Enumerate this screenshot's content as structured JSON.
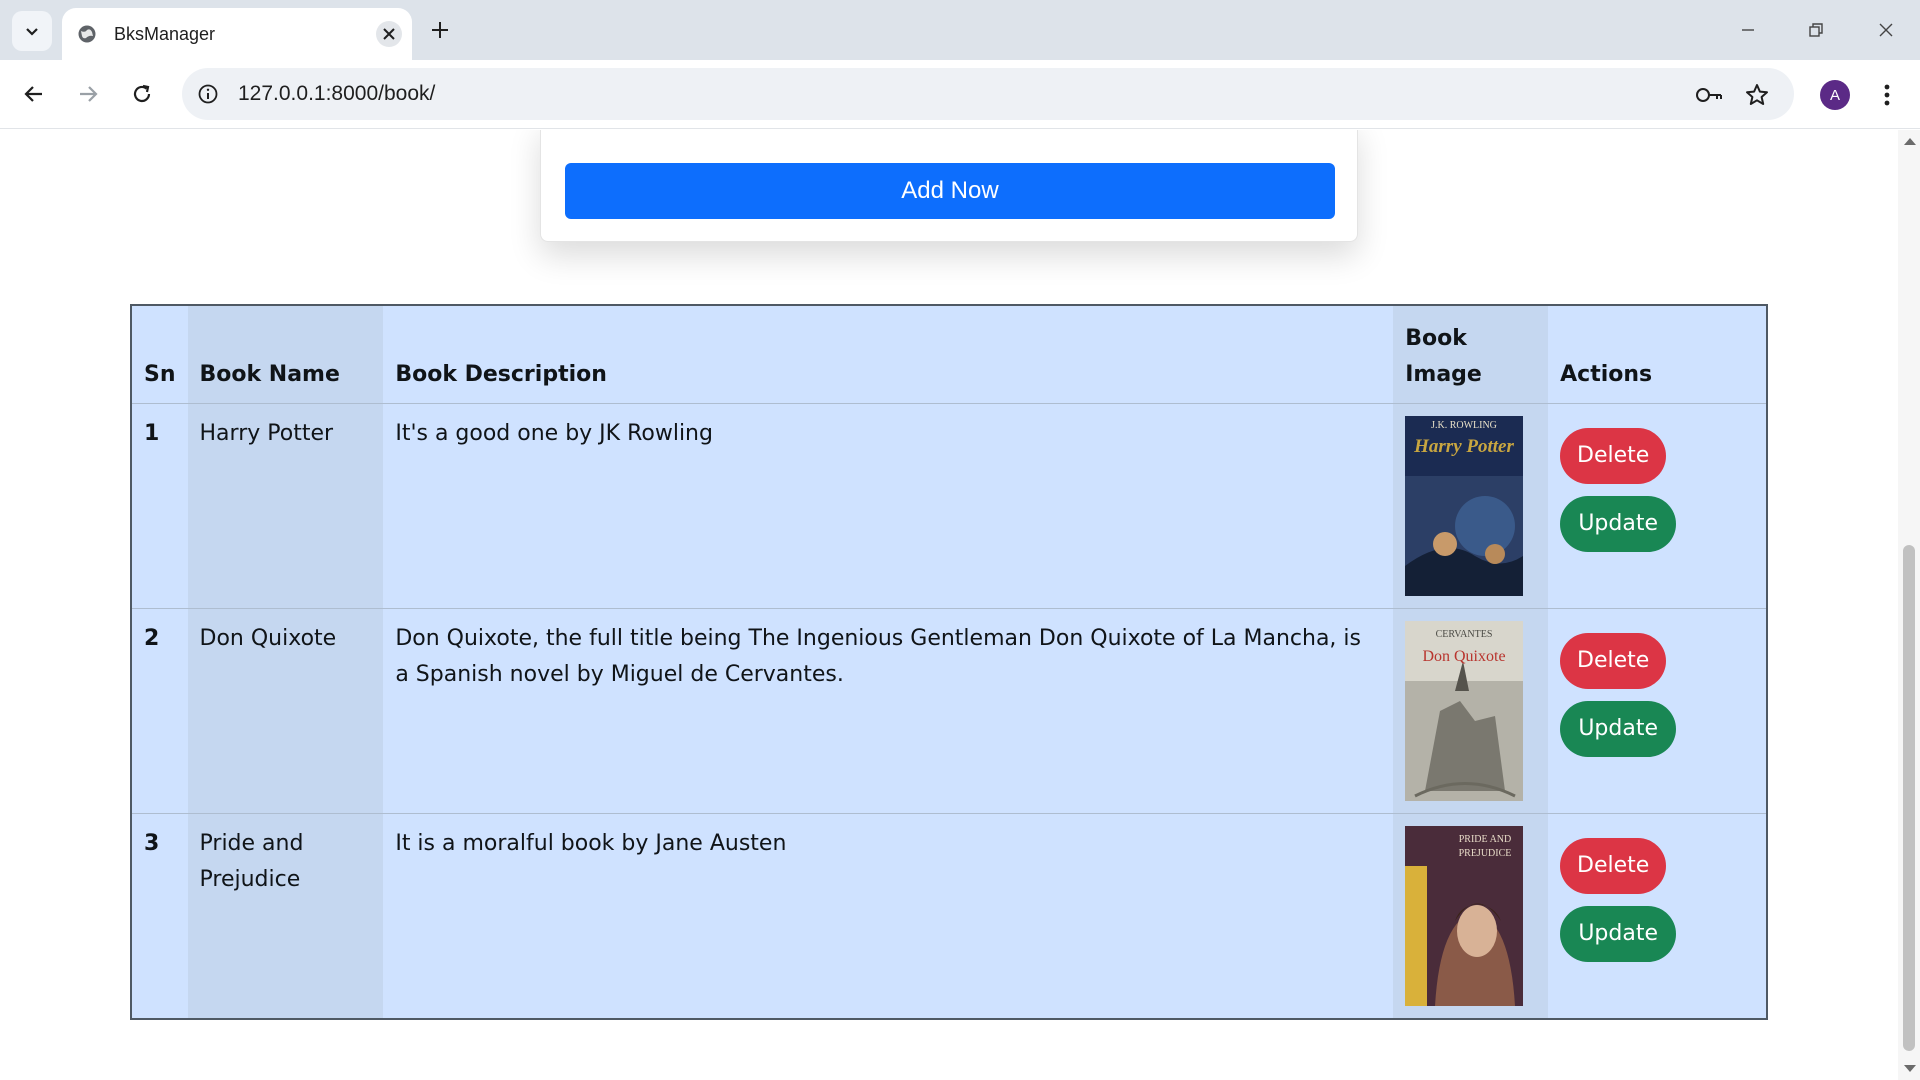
{
  "browser": {
    "tab_title": "BksManager",
    "url": "127.0.0.1:8000/book/",
    "avatar_letter": "A"
  },
  "form": {
    "submit_label": "Add Now"
  },
  "table": {
    "headers": {
      "sn": "Sn",
      "name": "Book Name",
      "description": "Book Description",
      "image": "Book Image",
      "actions": "Actions"
    },
    "rows": [
      {
        "sn": "1",
        "name": "Harry Potter",
        "description": "It's a good one by JK Rowling",
        "cover_text_top": "J.K. ROWLING",
        "cover_title": "Harry Potter",
        "cover_colors": [
          "#1b2b52",
          "#3a5a8a",
          "#c9a640"
        ],
        "delete_label": "Delete",
        "update_label": "Update"
      },
      {
        "sn": "2",
        "name": "Don Quixote",
        "description": "Don Quixote, the full title being The Ingenious Gentleman Don Quixote of La Mancha, is a Spanish novel by Miguel de Cervantes.",
        "cover_text_top": "CERVANTES",
        "cover_title": "Don Quixote",
        "cover_colors": [
          "#9a9a90",
          "#d8d6cc",
          "#b8352e"
        ],
        "delete_label": "Delete",
        "update_label": "Update"
      },
      {
        "sn": "3",
        "name": "Pride and Prejudice",
        "description": "It is a moralful book by Jane Austen",
        "cover_text_top": "PRIDE AND",
        "cover_title": "PREJUDICE",
        "cover_colors": [
          "#4a2c3a",
          "#b08a6a",
          "#d9b13a"
        ],
        "delete_label": "Delete",
        "update_label": "Update"
      }
    ]
  },
  "colors": {
    "primary": "#0d6efd",
    "danger": "#dc3545",
    "success": "#198754",
    "table_bg": "#cfe2ff"
  }
}
